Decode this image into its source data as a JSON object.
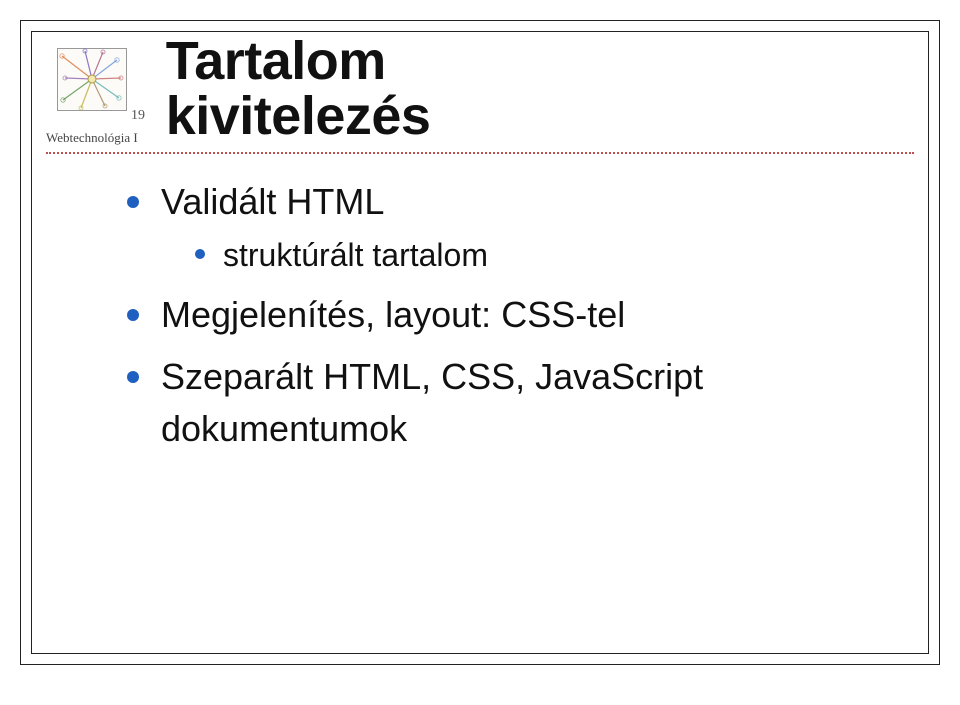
{
  "course_label": "Webtechnológia I",
  "slide_number": "19",
  "title_line1": "Tartalom",
  "title_line2": "kivitelezés",
  "bullets": {
    "b1": "Validált HTML",
    "b1_sub1": "struktúrált tartalom",
    "b2": "Megjelenítés, layout: CSS-tel",
    "b3": "Szeparált HTML, CSS, JavaScript dokumentumok"
  }
}
